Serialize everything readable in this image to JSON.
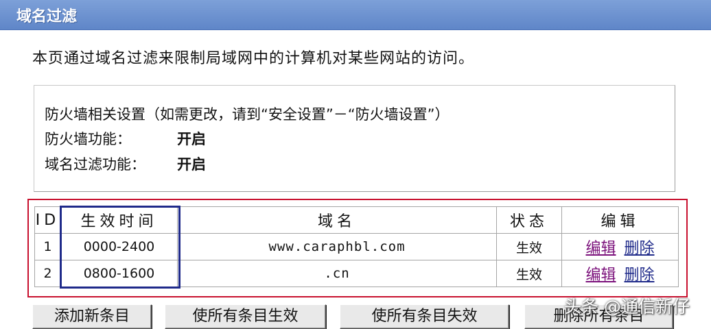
{
  "page": {
    "title": "域名过滤",
    "description": "本页通过域名过滤来限制局域网中的计算机对某些网站的访问。"
  },
  "firewall_info": {
    "heading": "防火墙相关设置（如需更改，请到“安全设置”－“防火墙设置”）",
    "firewall_label": "防火墙功能：",
    "firewall_value": "开启",
    "domain_filter_label": "域名过滤功能：",
    "domain_filter_value": "开启"
  },
  "table": {
    "headers": {
      "id": "ID",
      "time": "生效时间",
      "domain": "域名",
      "status": "状态",
      "edit": "编辑"
    },
    "rows": [
      {
        "id": "1",
        "time": "0000-2400",
        "domain": "www.caraphbl.com",
        "status": "生效",
        "edit": "编辑",
        "delete": "删除"
      },
      {
        "id": "2",
        "time": "0800-1600",
        "domain": ".cn",
        "status": "生效",
        "edit": "编辑",
        "delete": "删除"
      }
    ]
  },
  "buttons": {
    "add": "添加新条目",
    "enable_all": "使所有条目生效",
    "disable_all": "使所有条目失效",
    "delete_all": "删除所有条目"
  },
  "watermark": "头条 @通信新仔",
  "colors": {
    "title_bar": "#6b8fd0",
    "highlight_red": "#c8102e",
    "highlight_blue": "#1f2a8a",
    "edit_link": "#7a0f7a",
    "delete_link": "#1f2a8a"
  }
}
